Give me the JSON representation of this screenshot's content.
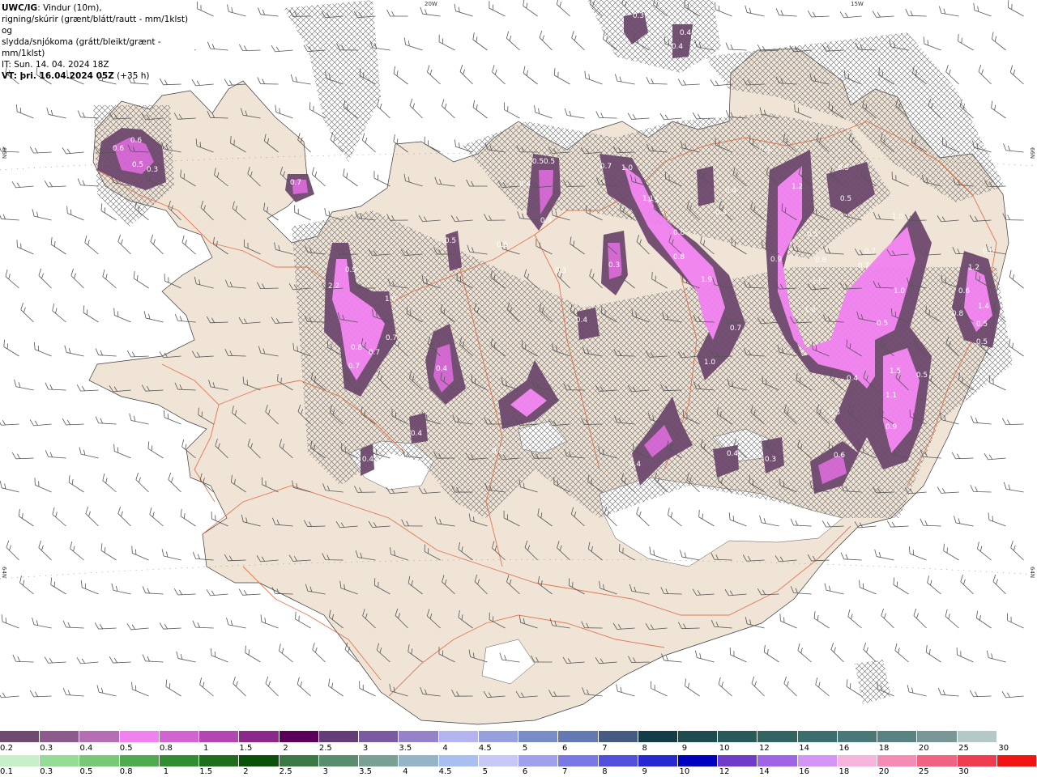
{
  "header": {
    "model": "UWC/IG",
    "line1_rest": ": Vindur (10m),",
    "line2": "rigning/skúrir (grænt/blátt/rautt - mm/1klst) og",
    "line3": "slydda/snjókoma (grátt/bleikt/grænt - mm/1klst)",
    "line4": "IT: Sun. 14. 04. 2024 18Z",
    "line5_bold": "VT: þri. 16.04.2024 05Z",
    "line5_rest": " (+35 h)"
  },
  "coords": {
    "top_20w": "20W",
    "top_15w": "15W",
    "left_66n": "66N",
    "right_66n": "66N",
    "left_64n": "64N",
    "right_64n": "64N"
  },
  "precip_labels": [
    "0.3",
    "0.4",
    "0.4",
    "0.5",
    "0.6",
    "0.6",
    "0.5",
    "0.3",
    "0.7",
    "2.2",
    "0.9",
    "0.8",
    "0.7",
    "0.7",
    "0.7",
    "1.0",
    "0.4",
    "0.4",
    "0.4",
    "0.5",
    "0.5",
    "0.4",
    "0.9",
    "0.5",
    "0.3",
    "0.4",
    "0.3",
    "0.7",
    "1.0",
    "1.1",
    "1.5",
    "0.8",
    "0.8",
    "1.9",
    "0.7",
    "1.0",
    "0.4",
    "0.4",
    "0.5",
    "1.2",
    "0.9",
    "1.0",
    "1.4",
    "0.8",
    "0.5",
    "0.5",
    "1.0",
    "0.7",
    "0.7",
    "1.0",
    "0.5",
    "0.4",
    "1.5",
    "1.1",
    "0.9",
    "0.5",
    "0.6",
    "1.2",
    "0.6",
    "0.8",
    "1.4",
    "0.5",
    "0.3",
    "0.4",
    "0.4",
    "0.3",
    "0.6",
    "0.4",
    "0.3",
    "0.5"
  ],
  "legend": {
    "snow_colors": [
      "#6e4a6e",
      "#8c5a8c",
      "#b46eb4",
      "#f082f0",
      "#d264d2",
      "#b446b4",
      "#8c288c",
      "#5a005a",
      "#643c78",
      "#7a5aa0",
      "#9682c8",
      "#b4b4f0",
      "#96a0dc",
      "#7a8cc8",
      "#6478b4",
      "#465a82",
      "#143c46",
      "#1e4a50",
      "#285a5a",
      "#326464",
      "#3c6e6e",
      "#4a7878",
      "#5a8282",
      "#7a9696",
      "#b4c8c8",
      "#ffffff"
    ],
    "snow_labels": [
      "0.2",
      "0.3",
      "0.4",
      "0.5",
      "0.8",
      "1",
      "1.5",
      "2",
      "2.5",
      "3",
      "3.5",
      "4",
      "4.5",
      "5",
      "6",
      "7",
      "8",
      "9",
      "10",
      "12",
      "14",
      "16",
      "18",
      "20",
      "25",
      "30"
    ],
    "rain_colors": [
      "#c8f0c8",
      "#96dc96",
      "#78c878",
      "#50aa50",
      "#328c32",
      "#1e6e1e",
      "#0a500a",
      "#3c7846",
      "#5a8c6e",
      "#7aa096",
      "#96b4c8",
      "#aabef0",
      "#c8c8f5",
      "#a0a0eb",
      "#7878e6",
      "#5050dc",
      "#2828d2",
      "#0000be",
      "#6e3cc8",
      "#a064e6",
      "#d296f5",
      "#f5b4dc",
      "#f58cb4",
      "#f06482",
      "#f03c50",
      "#f01414"
    ],
    "rain_labels": [
      "0.1",
      "0.3",
      "0.5",
      "0.8",
      "1",
      "1.5",
      "2",
      "2.5",
      "3",
      "3.5",
      "4",
      "4.5",
      "5",
      "6",
      "7",
      "8",
      "9",
      "10",
      "12",
      "14",
      "16",
      "18",
      "20",
      "25",
      "30"
    ]
  }
}
